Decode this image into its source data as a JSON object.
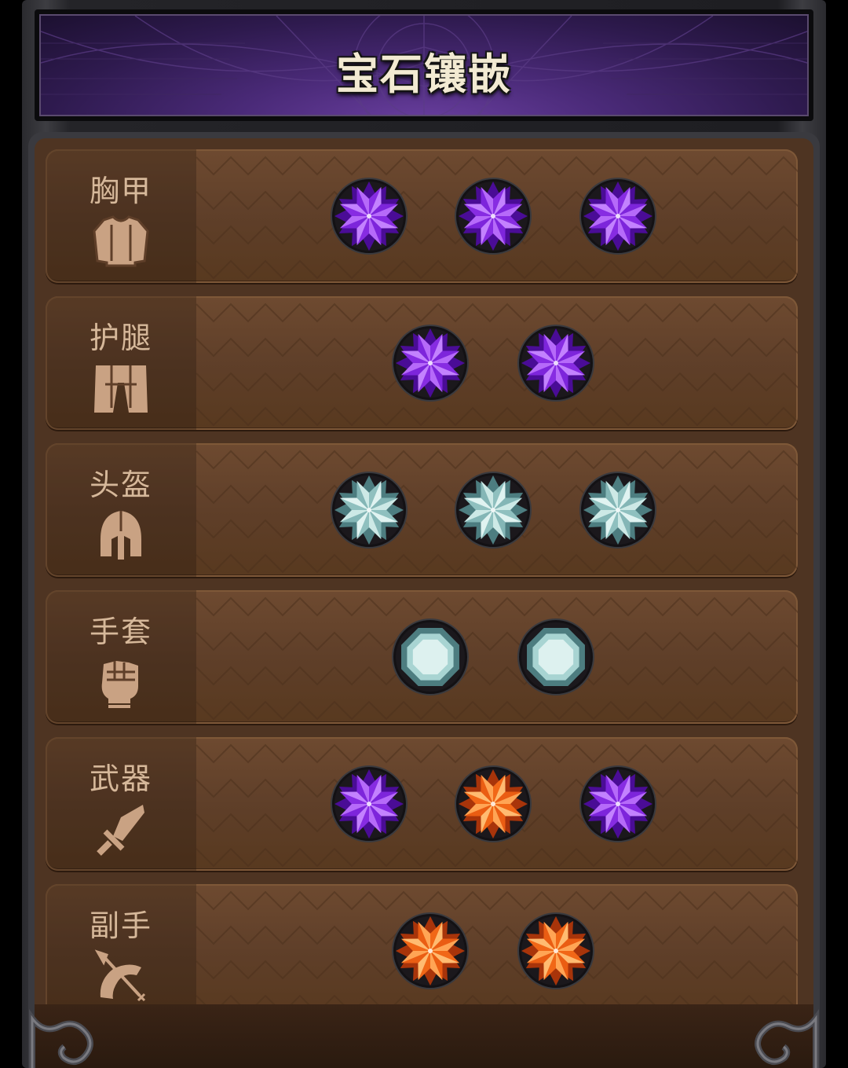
{
  "title": "宝石镶嵌",
  "colors": {
    "purple_gem": "#9b3df0",
    "orange_gem": "#ff7a1e",
    "teal_gem": "#a8d4d2",
    "label_text": "#d6b89a",
    "row_bg": "#5f3f29"
  },
  "rows": [
    {
      "label": "胸甲",
      "icon": "chest-armor-icon",
      "gems": [
        "purple-star",
        "purple-star",
        "purple-star"
      ]
    },
    {
      "label": "护腿",
      "icon": "leggings-icon",
      "gems": [
        "purple-star",
        "purple-star"
      ]
    },
    {
      "label": "头盔",
      "icon": "helmet-icon",
      "gems": [
        "teal-star",
        "teal-star",
        "teal-star"
      ]
    },
    {
      "label": "手套",
      "icon": "fist-icon",
      "gems": [
        "teal-octagon",
        "teal-octagon"
      ]
    },
    {
      "label": "武器",
      "icon": "sword-icon",
      "gems": [
        "purple-star",
        "orange-star",
        "purple-star"
      ]
    },
    {
      "label": "副手",
      "icon": "bow-icon",
      "gems": [
        "orange-star",
        "orange-star"
      ]
    }
  ]
}
